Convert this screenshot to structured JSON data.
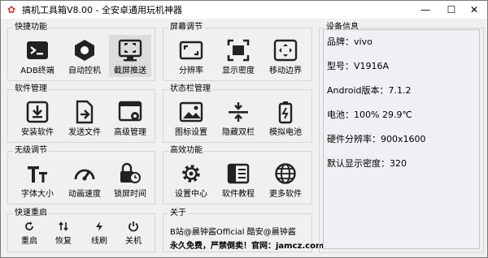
{
  "window": {
    "title": "搞机工具箱V8.00 - 全安卓通用玩机神器",
    "min": "—",
    "max": "☐",
    "close": "✕"
  },
  "groups": {
    "quick": {
      "title": "快捷功能",
      "items": [
        {
          "label": "ADB终端"
        },
        {
          "label": "自动控机"
        },
        {
          "label": "截屏推送"
        }
      ]
    },
    "screen": {
      "title": "屏幕调节",
      "items": [
        {
          "label": "分辨率"
        },
        {
          "label": "显示密度"
        },
        {
          "label": "移动边界"
        }
      ]
    },
    "software": {
      "title": "软件管理",
      "items": [
        {
          "label": "安装软件"
        },
        {
          "label": "发送文件"
        },
        {
          "label": "高级管理"
        }
      ]
    },
    "statusbar": {
      "title": "状态栏管理",
      "items": [
        {
          "label": "图标设置"
        },
        {
          "label": "隐藏双栏"
        },
        {
          "label": "模拟电池"
        }
      ]
    },
    "nolimit": {
      "title": "无级调节",
      "items": [
        {
          "label": "字体大小"
        },
        {
          "label": "动画速度"
        },
        {
          "label": "锁屏时间"
        }
      ]
    },
    "advanced": {
      "title": "高效功能",
      "items": [
        {
          "label": "设置中心"
        },
        {
          "label": "软件教程"
        },
        {
          "label": "更多软件"
        }
      ]
    },
    "reboot": {
      "title": "快速重启",
      "items": [
        {
          "label": "重启"
        },
        {
          "label": "恢复"
        },
        {
          "label": "线刷"
        },
        {
          "label": "关机"
        }
      ]
    },
    "about": {
      "title": "关于",
      "line1": "B站@晨钟酱Official   酷安@晨钟酱",
      "line2": "永久免费，严禁倒卖！官网：jamcz.com"
    }
  },
  "device": {
    "title": "设备信息",
    "rows": [
      "品牌：vivo",
      "型号：V1916A",
      "Android版本：7.1.2",
      "电池：100%   29.9℃",
      "硬件分辨率：900x1600",
      "默认显示密度：320"
    ]
  },
  "icons": {
    "accent": "#222222",
    "selected_bg": "#dcdcdc"
  }
}
